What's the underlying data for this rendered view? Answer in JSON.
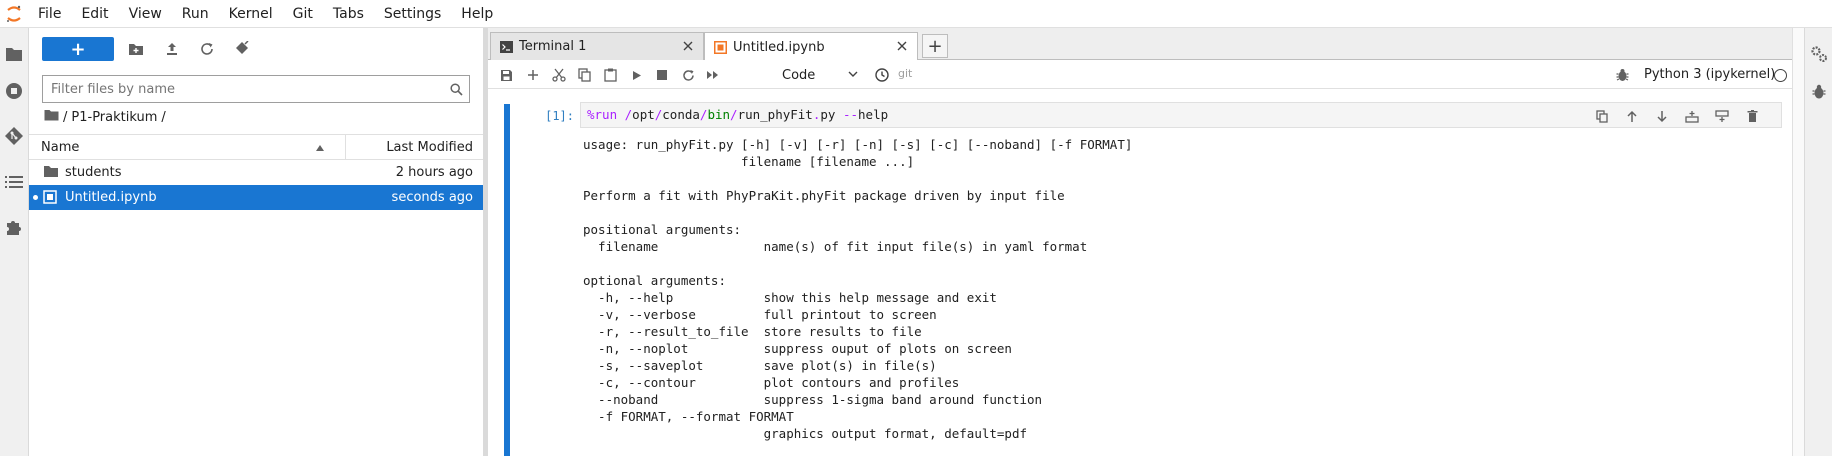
{
  "menu": [
    "File",
    "Edit",
    "View",
    "Run",
    "Kernel",
    "Git",
    "Tabs",
    "Settings",
    "Help"
  ],
  "filebrowser": {
    "new_button": "+",
    "filter_placeholder": "Filter files by name",
    "breadcrumb_root": "/",
    "breadcrumb_folder": "P1-Praktikum",
    "breadcrumb_trail": "/",
    "header_name": "Name",
    "header_modified": "Last Modified",
    "files": [
      {
        "name": "students",
        "modified": "2 hours ago",
        "type": "folder"
      },
      {
        "name": "Untitled.ipynb",
        "modified": "seconds ago",
        "type": "notebook"
      }
    ]
  },
  "tabs": [
    {
      "label": "Terminal 1",
      "icon": "terminal-icon"
    },
    {
      "label": "Untitled.ipynb",
      "icon": "notebook-icon"
    }
  ],
  "toolbar": {
    "cell_type": "Code",
    "git_label": "git",
    "kernel_name": "Python 3 (ipykernel)"
  },
  "cell": {
    "prompt": "[1]:",
    "magic": "%run",
    "path_parts": [
      " ",
      "/",
      "opt",
      "/",
      "conda",
      "/",
      "bin",
      "/",
      "run_phyFit",
      ".",
      "py",
      " ",
      "--",
      "help"
    ],
    "output": "usage: run_phyFit.py [-h] [-v] [-r] [-n] [-s] [-c] [--noband] [-f FORMAT]\n                     filename [filename ...]\n\nPerform a fit with PhyPraKit.phyFit package driven by input file\n\npositional arguments:\n  filename              name(s) of fit input file(s) in yaml format\n\noptional arguments:\n  -h, --help            show this help message and exit\n  -v, --verbose         full printout to screen\n  -r, --result_to_file  store results to file\n  -n, --noplot          suppress ouput of plots on screen\n  -s, --saveplot        save plot(s) in file(s)\n  -c, --contour         plot contours and profiles\n  --noband              suppress 1-sigma band around function\n  -f FORMAT, --format FORMAT\n                        graphics output format, default=pdf"
  },
  "colors": {
    "accent": "#1976d2",
    "magic": "#aa22ff",
    "keyword": "#008000",
    "prompt": "#307fc1",
    "jupyter_orange": "#f37726"
  }
}
